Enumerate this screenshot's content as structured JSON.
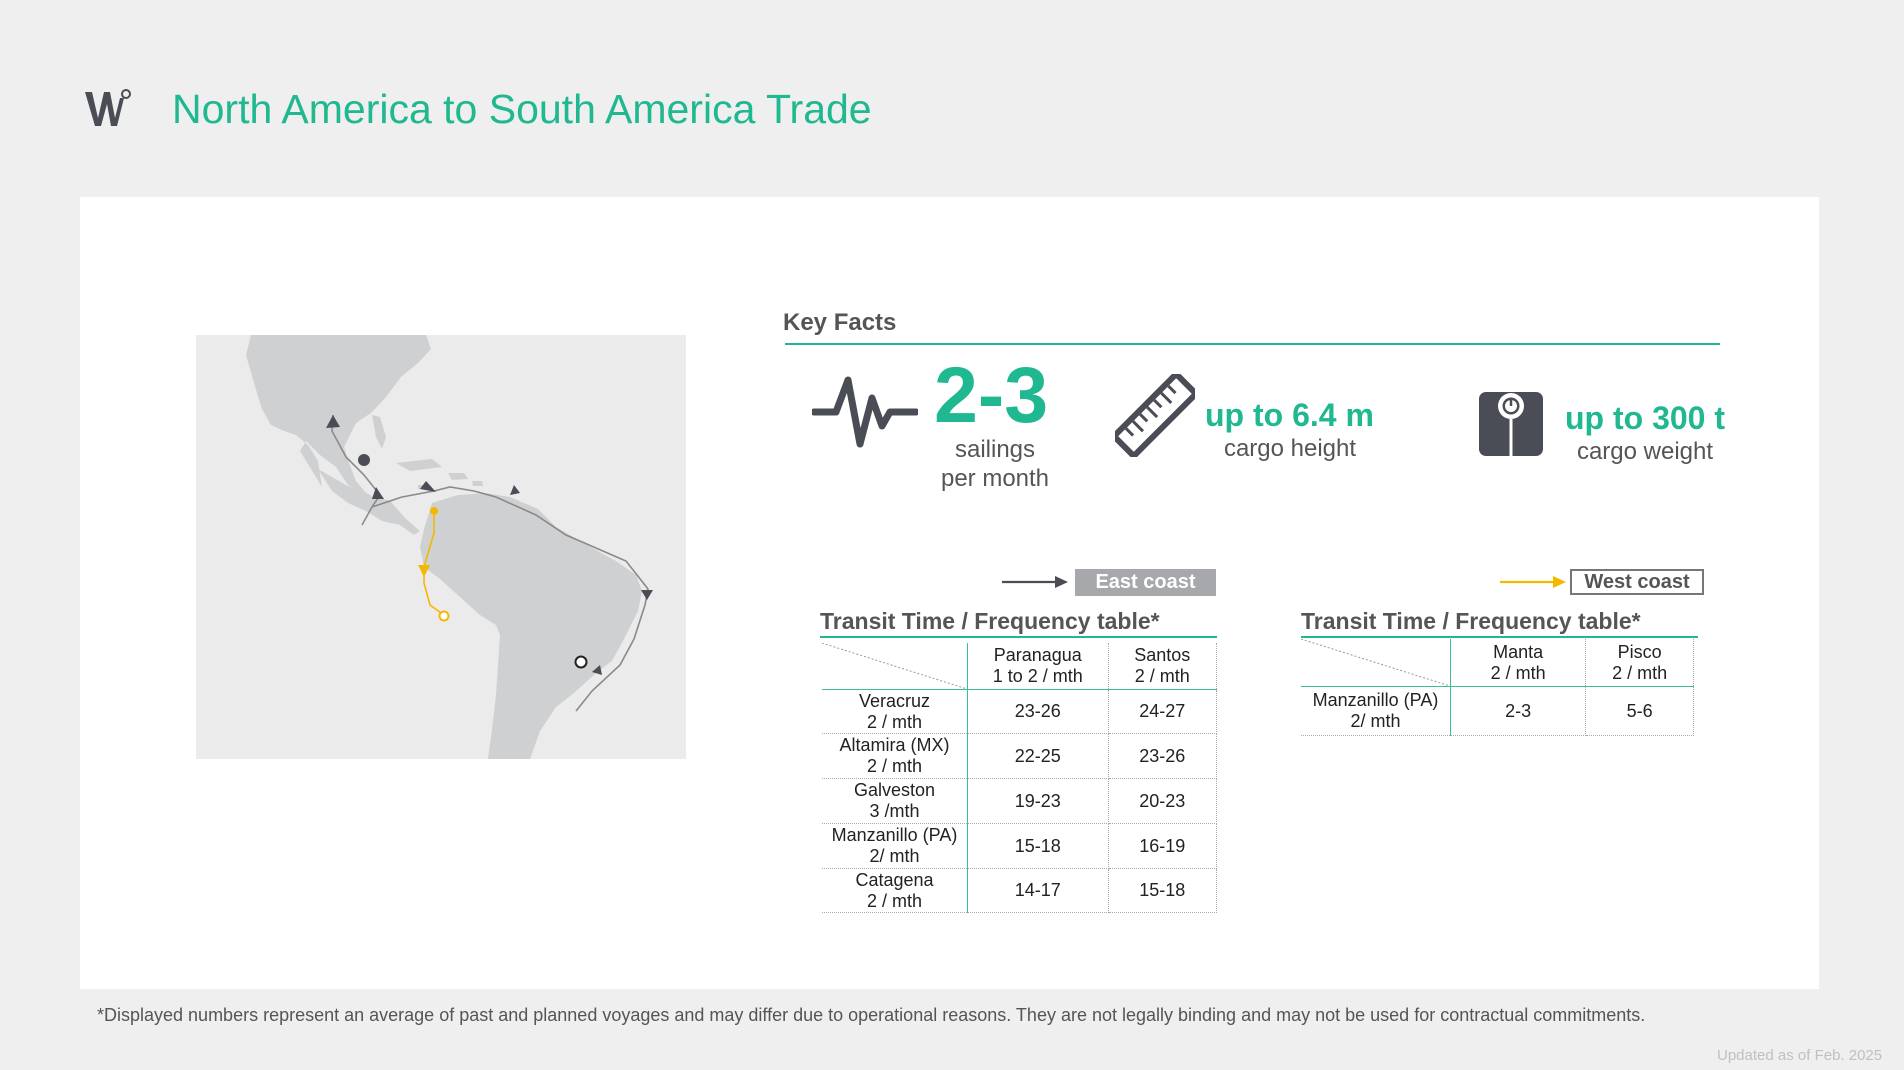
{
  "header": {
    "title": "North America to South America Trade",
    "logo_icon": "w-logo-icon"
  },
  "key_facts": {
    "heading": "Key Facts",
    "sailings": {
      "value": "2-3",
      "label_line1": "sailings",
      "label_line2": "per month",
      "icon": "pulse-icon"
    },
    "height": {
      "value": "up to 6.4 m",
      "label": "cargo height",
      "icon": "ruler-icon"
    },
    "weight": {
      "value": "up to 300 t",
      "label": "cargo weight",
      "icon": "weight-scale-icon"
    }
  },
  "east": {
    "legend": "East coast",
    "title": "Transit Time / Frequency table*",
    "columns": [
      {
        "l1": "Paranagua",
        "l2": "1 to 2 / mth"
      },
      {
        "l1": "Santos",
        "l2": "2 / mth"
      }
    ],
    "rows": [
      {
        "l1": "Veracruz",
        "l2": "2 / mth",
        "v1": "23-26",
        "v2": "24-27"
      },
      {
        "l1": "Altamira (MX)",
        "l2": "2 / mth",
        "v1": "22-25",
        "v2": "23-26"
      },
      {
        "l1": "Galveston",
        "l2": "3 /mth",
        "v1": "19-23",
        "v2": "20-23"
      },
      {
        "l1": "Manzanillo (PA)",
        "l2": "2/ mth",
        "v1": "15-18",
        "v2": "16-19"
      },
      {
        "l1": "Catagena",
        "l2": "2 / mth",
        "v1": "14-17",
        "v2": "15-18"
      }
    ]
  },
  "west": {
    "legend": "West coast",
    "title": "Transit Time / Frequency table*",
    "columns": [
      {
        "l1": "Manta",
        "l2": "2 / mth"
      },
      {
        "l1": "Pisco",
        "l2": "2 / mth"
      }
    ],
    "rows": [
      {
        "l1": "Manzanillo (PA)",
        "l2": "2/ mth",
        "v1": "2-3",
        "v2": "5-6"
      }
    ]
  },
  "colors": {
    "accent": "#1fb890",
    "east_route": "#8c8c8c",
    "west_route": "#f5b800"
  },
  "footer": {
    "note": "*Displayed numbers represent an average of past and planned voyages and may differ due to operational reasons. They are not legally binding and may not be used for contractual commitments.",
    "updated": "Updated as of Feb. 2025"
  }
}
